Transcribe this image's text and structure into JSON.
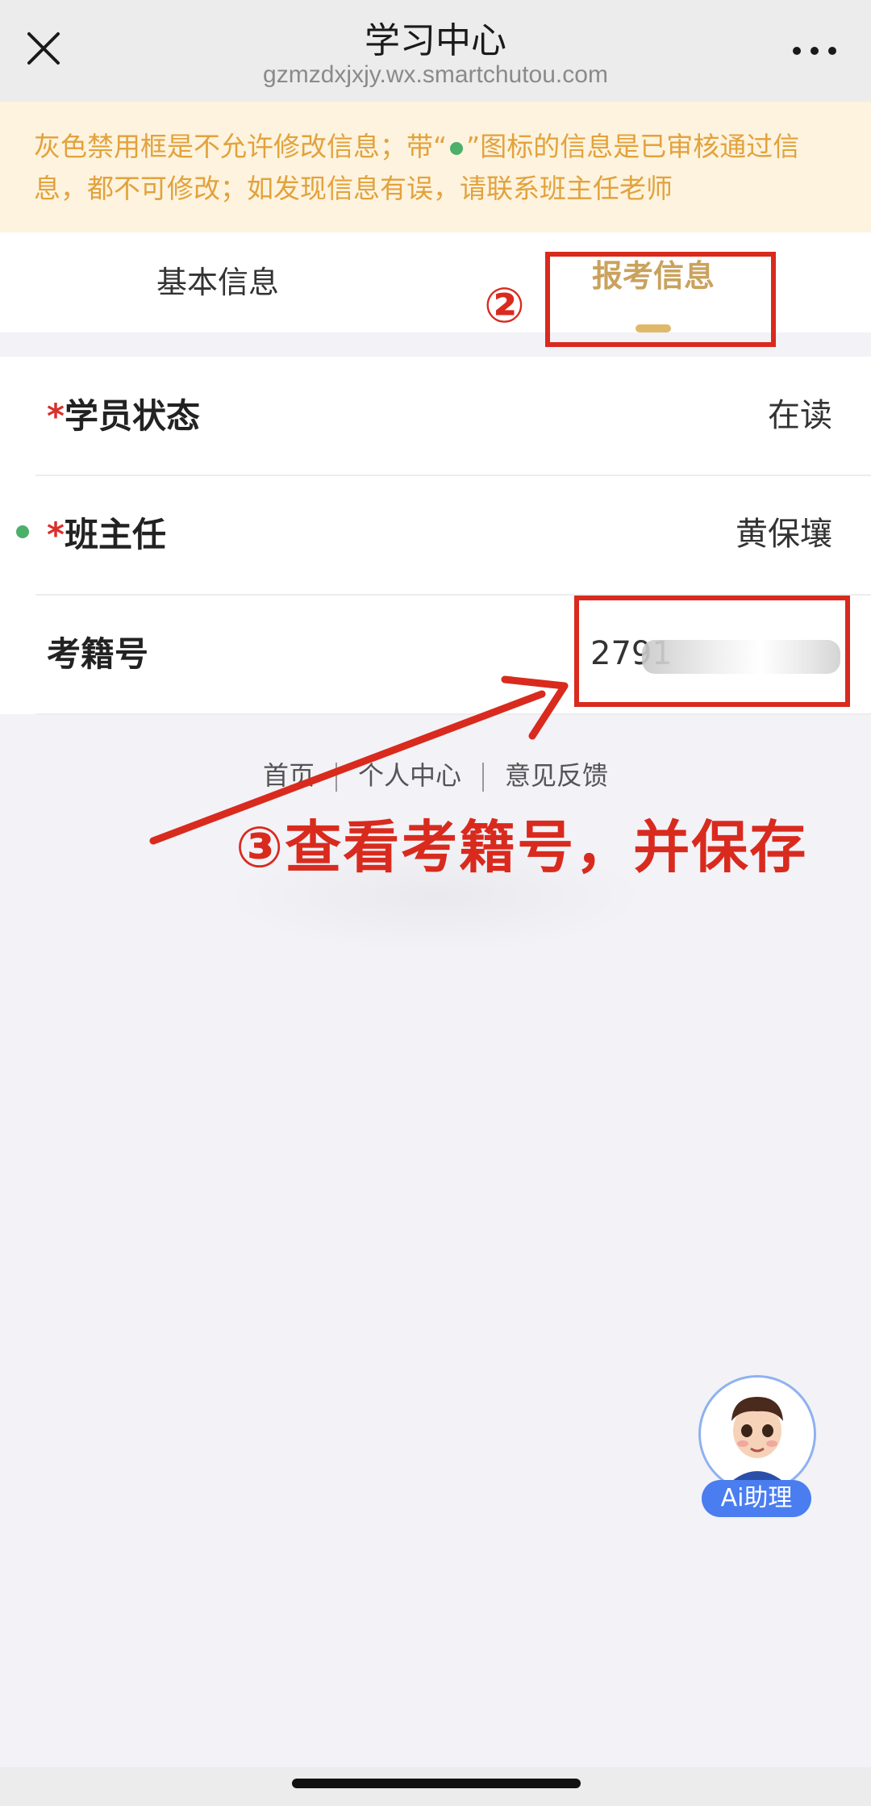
{
  "header": {
    "title": "学习中心",
    "url": "gzmzdxjxjy.wx.smartchutou.com"
  },
  "notice": {
    "text_before": "灰色禁用框是不允许修改信息；带“",
    "text_after": "”图标的信息是已审核通过信息，都不可修改；如发现信息有误，请联系班主任老师"
  },
  "tabs": [
    {
      "label": "基本信息",
      "active": false
    },
    {
      "label": "报考信息",
      "active": true
    }
  ],
  "rows": [
    {
      "label": "学员状态",
      "required": "*",
      "value": "在读"
    },
    {
      "label": "班主任",
      "required": "*",
      "value": "黄保壤",
      "verified": true
    },
    {
      "label": "考籍号",
      "value": "2791"
    }
  ],
  "footer": {
    "links": [
      "首页",
      "个人中心",
      "意见反馈"
    ]
  },
  "annotations": {
    "step2": "②",
    "step3": "③查看考籍号，并保存"
  },
  "ai_assistant": {
    "label": "Ai助理"
  },
  "colors": {
    "accent_gold": "#c9a25e",
    "notice_text": "#e2a23c",
    "annotation_red": "#d92a1e",
    "verified_green": "#4caf6a",
    "ai_blue": "#4a7df0"
  }
}
